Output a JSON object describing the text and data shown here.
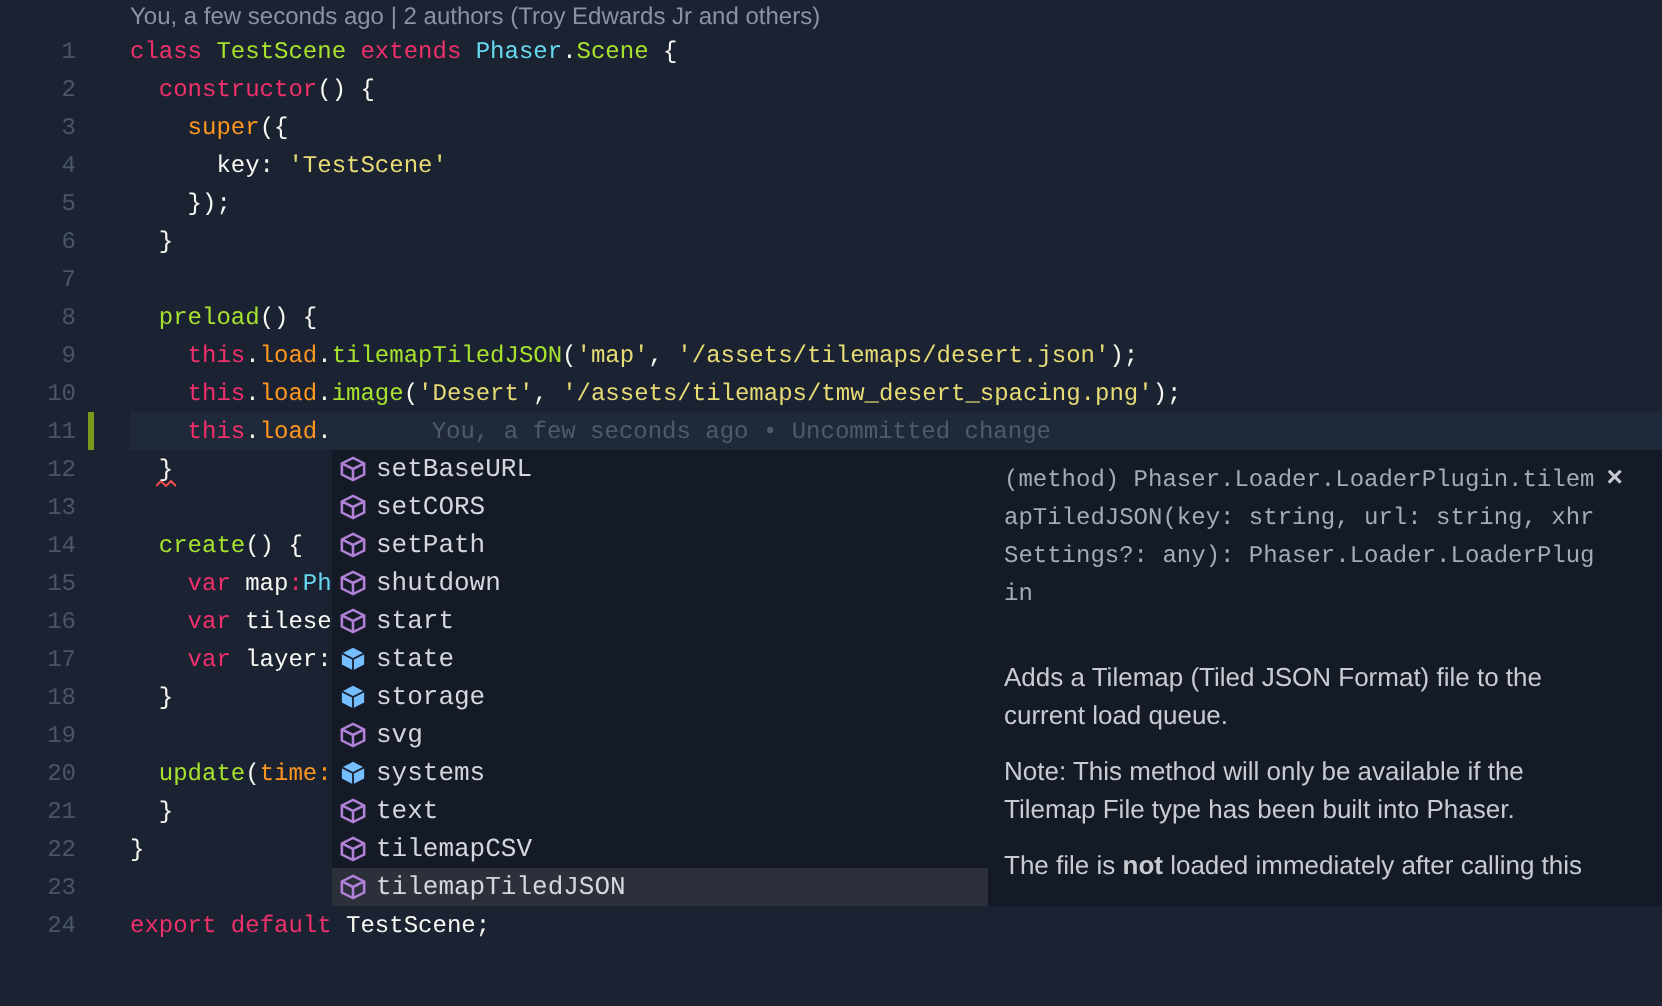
{
  "blame_header": "You, a few seconds ago | 2 authors (Troy Edwards Jr and others)",
  "lines": [
    {
      "number": "1",
      "tokens": [
        {
          "t": "class ",
          "kind": "keyword"
        },
        {
          "t": "TestScene ",
          "kind": "class"
        },
        {
          "t": "extends ",
          "kind": "keyword"
        },
        {
          "t": "Phaser",
          "kind": "type"
        },
        {
          "t": ".",
          "kind": "plain"
        },
        {
          "t": "Scene",
          "kind": "class"
        },
        {
          "t": " {",
          "kind": "plain"
        }
      ]
    },
    {
      "number": "2",
      "tokens": [
        {
          "t": "  constructor",
          "kind": "keyword"
        },
        {
          "t": "() {",
          "kind": "plain"
        }
      ]
    },
    {
      "number": "3",
      "tokens": [
        {
          "t": "    super",
          "kind": "builtin"
        },
        {
          "t": "({",
          "kind": "plain"
        }
      ]
    },
    {
      "number": "4",
      "tokens": [
        {
          "t": "      key: ",
          "kind": "plain"
        },
        {
          "t": "'TestScene'",
          "kind": "string"
        }
      ]
    },
    {
      "number": "5",
      "tokens": [
        {
          "t": "    });",
          "kind": "plain"
        }
      ]
    },
    {
      "number": "6",
      "tokens": [
        {
          "t": "  }",
          "kind": "plain"
        }
      ]
    },
    {
      "number": "7"
    },
    {
      "number": "8",
      "tokens": [
        {
          "t": "  preload",
          "kind": "function"
        },
        {
          "t": "() {",
          "kind": "plain"
        }
      ]
    },
    {
      "number": "9",
      "tokens": [
        {
          "t": "    this",
          "kind": "keyword"
        },
        {
          "t": ".",
          "kind": "plain"
        },
        {
          "t": "load",
          "kind": "builtin"
        },
        {
          "t": ".",
          "kind": "plain"
        },
        {
          "t": "tilemapTiledJSON",
          "kind": "function"
        },
        {
          "t": "(",
          "kind": "plain"
        },
        {
          "t": "'map'",
          "kind": "string"
        },
        {
          "t": ", ",
          "kind": "plain"
        },
        {
          "t": "'/assets/tilemaps/desert.json'",
          "kind": "string"
        },
        {
          "t": ");",
          "kind": "plain"
        }
      ]
    },
    {
      "number": "10",
      "tokens": [
        {
          "t": "    this",
          "kind": "keyword"
        },
        {
          "t": ".",
          "kind": "plain"
        },
        {
          "t": "load",
          "kind": "builtin"
        },
        {
          "t": ".",
          "kind": "plain"
        },
        {
          "t": "image",
          "kind": "function"
        },
        {
          "t": "(",
          "kind": "plain"
        },
        {
          "t": "'Desert'",
          "kind": "string"
        },
        {
          "t": ", ",
          "kind": "plain"
        },
        {
          "t": "'/assets/tilemaps/tmw_desert_spacing.png'",
          "kind": "string"
        },
        {
          "t": ");",
          "kind": "plain"
        }
      ]
    },
    {
      "number": "11",
      "current": true,
      "modified": true,
      "blame": "You, a few seconds ago • Uncommitted change",
      "tokens": [
        {
          "t": "    this",
          "kind": "keyword"
        },
        {
          "t": ".",
          "kind": "plain"
        },
        {
          "t": "load",
          "kind": "builtin"
        },
        {
          "t": ".",
          "kind": "plain"
        }
      ]
    },
    {
      "number": "12",
      "error": true,
      "tokens": [
        {
          "t": "  }",
          "kind": "plain"
        }
      ]
    },
    {
      "number": "13"
    },
    {
      "number": "14",
      "tokens": [
        {
          "t": "  create",
          "kind": "function"
        },
        {
          "t": "() {",
          "kind": "plain"
        }
      ]
    },
    {
      "number": "15",
      "tokens": [
        {
          "t": "    var ",
          "kind": "keyword"
        },
        {
          "t": "map",
          "kind": "plain"
        },
        {
          "t": ":",
          "kind": "keyword"
        },
        {
          "t": "Ph",
          "kind": "type"
        }
      ]
    },
    {
      "number": "16",
      "tokens": [
        {
          "t": "    var ",
          "kind": "keyword"
        },
        {
          "t": "tilese",
          "kind": "plain"
        }
      ]
    },
    {
      "number": "17",
      "tokens": [
        {
          "t": "    var ",
          "kind": "keyword"
        },
        {
          "t": "layer:",
          "kind": "plain"
        }
      ]
    },
    {
      "number": "18",
      "tokens": [
        {
          "t": "  }",
          "kind": "plain"
        }
      ]
    },
    {
      "number": "19"
    },
    {
      "number": "20",
      "tokens": [
        {
          "t": "  update",
          "kind": "function"
        },
        {
          "t": "(",
          "kind": "plain"
        },
        {
          "t": "time:",
          "kind": "builtin"
        }
      ]
    },
    {
      "number": "21",
      "tokens": [
        {
          "t": "  }",
          "kind": "plain"
        }
      ]
    },
    {
      "number": "22",
      "tokens": [
        {
          "t": "}",
          "kind": "plain"
        }
      ]
    },
    {
      "number": "23"
    },
    {
      "number": "24",
      "tokens": [
        {
          "t": "export ",
          "kind": "keyword"
        },
        {
          "t": "default ",
          "kind": "keyword"
        },
        {
          "t": "TestScene;",
          "kind": "plain"
        }
      ]
    }
  ],
  "suggestions": [
    {
      "label": "setBaseURL",
      "kind": "method",
      "selected": false
    },
    {
      "label": "setCORS",
      "kind": "method",
      "selected": false
    },
    {
      "label": "setPath",
      "kind": "method",
      "selected": false
    },
    {
      "label": "shutdown",
      "kind": "method",
      "selected": false
    },
    {
      "label": "start",
      "kind": "method",
      "selected": false
    },
    {
      "label": "state",
      "kind": "property",
      "selected": false
    },
    {
      "label": "storage",
      "kind": "property",
      "selected": false
    },
    {
      "label": "svg",
      "kind": "method",
      "selected": false
    },
    {
      "label": "systems",
      "kind": "property",
      "selected": false
    },
    {
      "label": "text",
      "kind": "method",
      "selected": false
    },
    {
      "label": "tilemapCSV",
      "kind": "method",
      "selected": false
    },
    {
      "label": "tilemapTiledJSON",
      "kind": "method",
      "selected": true
    }
  ],
  "details": {
    "close": "×",
    "signature": "(method) Phaser.Loader.LoaderPlugin.tilemapTiledJSON(key: string, url: string, xhrSettings?: any): Phaser.Loader.LoaderPlugin",
    "paragraphs": [
      "Adds a Tilemap (Tiled JSON Format) file to the current load queue.",
      "Note: This method will only be available if the Tilemap File type has been built into Phaser.",
      "The file is **not** loaded immediately after calling this"
    ]
  }
}
